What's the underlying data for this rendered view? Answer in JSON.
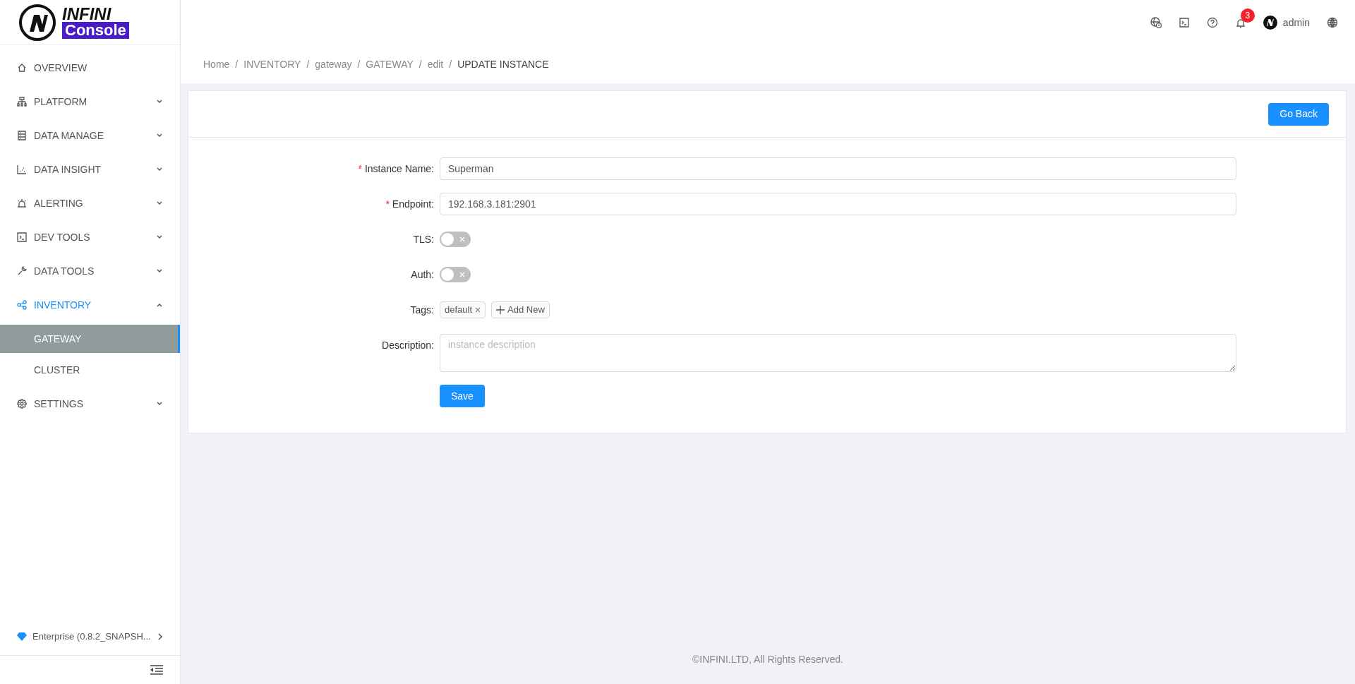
{
  "logo": {
    "line_1": "INFINI",
    "line_2": "Console"
  },
  "header": {
    "notifications": "3",
    "user": "admin"
  },
  "sidebar": {
    "items": [
      {
        "label": "OVERVIEW",
        "selected": false
      },
      {
        "label": "PLATFORM",
        "expanded": false,
        "selected": false
      },
      {
        "label": "DATA MANAGE",
        "expanded": false,
        "selected": false
      },
      {
        "label": "DATA INSIGHT",
        "expanded": false,
        "selected": false
      },
      {
        "label": "ALERTING",
        "expanded": false,
        "selected": false
      },
      {
        "label": "DEV TOOLS",
        "expanded": false,
        "selected": false
      },
      {
        "label": "DATA TOOLS",
        "expanded": false,
        "selected": false
      },
      {
        "label": "INVENTORY",
        "expanded": true,
        "selected": true,
        "children": [
          {
            "label": "GATEWAY",
            "selected": true
          },
          {
            "label": "CLUSTER",
            "selected": false
          }
        ]
      },
      {
        "label": "SETTINGS",
        "expanded": false,
        "selected": false
      }
    ],
    "version": "Enterprise (0.8.2_SNAPSH..."
  },
  "breadcrumb": [
    {
      "label": "Home"
    },
    {
      "separator": "/",
      "label": "INVENTORY"
    },
    {
      "separator": "/",
      "label": "gateway"
    },
    {
      "separator": "/",
      "label": "GATEWAY"
    },
    {
      "separator": "/",
      "label": "edit"
    },
    {
      "separator": "/",
      "label": "UPDATE INSTANCE"
    }
  ],
  "go_back": "Go Back",
  "form": {
    "fields": [
      {
        "kind": "text",
        "required_mark": "*",
        "label": "Instance Name:",
        "value": "Superman"
      },
      {
        "kind": "text",
        "required_mark": "*",
        "label": "Endpoint:",
        "value": "192.168.3.181:2901"
      },
      {
        "kind": "switch",
        "label": "TLS:",
        "on": false
      },
      {
        "kind": "switch",
        "label": "Auth:",
        "on": false
      },
      {
        "kind": "tags",
        "label": "Tags:",
        "tags": [
          "default"
        ],
        "add_label": "Add New"
      },
      {
        "kind": "textarea",
        "label": "Description:",
        "placeholder": "instance description"
      }
    ],
    "save": "Save"
  },
  "footer": "©INFINI.LTD, All Rights Reserved."
}
